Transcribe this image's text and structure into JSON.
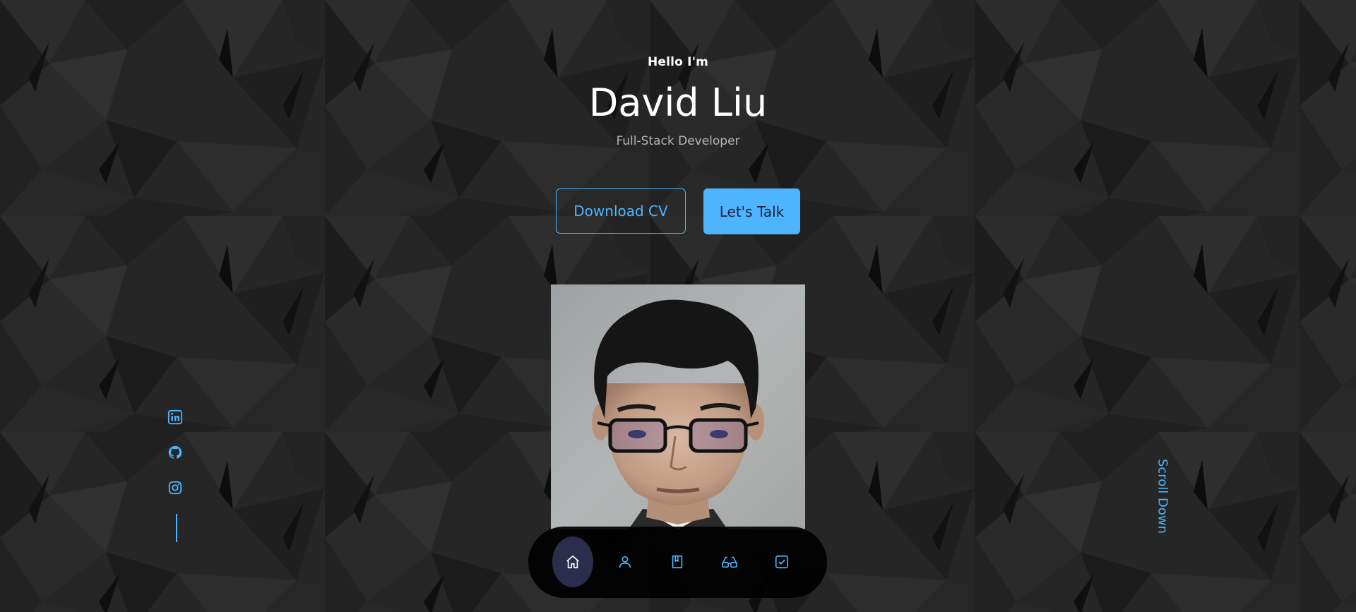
{
  "header": {
    "greeting": "Hello I'm",
    "name": "David Liu",
    "role": "Full-Stack Developer"
  },
  "cta": {
    "download_cv_label": "Download CV",
    "lets_talk_label": "Let's Talk"
  },
  "portrait": {
    "alt": "David Liu portrait"
  },
  "socials": [
    {
      "name": "linkedin",
      "icon": "linkedin-icon"
    },
    {
      "name": "github",
      "icon": "github-icon"
    },
    {
      "name": "instagram",
      "icon": "instagram-icon"
    }
  ],
  "scroll_down_label": "Scroll Down",
  "nav": {
    "items": [
      {
        "icon": "home-icon",
        "active": true
      },
      {
        "icon": "user-icon",
        "active": false
      },
      {
        "icon": "book-icon",
        "active": false
      },
      {
        "icon": "glasses-icon",
        "active": false
      },
      {
        "icon": "checkbox-icon",
        "active": false
      }
    ]
  },
  "colors": {
    "accent": "#4db5ff",
    "background": "#242424",
    "nav_background": "#000000",
    "nav_active": "#2c2c4c",
    "text": "#ffffff",
    "muted_text": "#b5b5b8"
  }
}
